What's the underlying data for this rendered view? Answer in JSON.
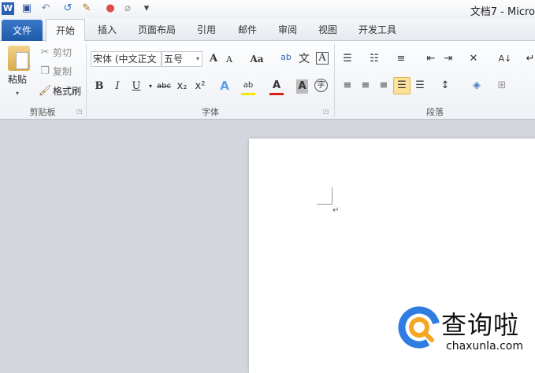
{
  "titlebar": {
    "title": "文档7 - Micro",
    "quick_access": [
      "word-logo-icon",
      "save-icon",
      "undo-icon",
      "redo-icon",
      "format-icon",
      "color-icon",
      "draw-icon",
      "customize-icon"
    ]
  },
  "tabs": [
    {
      "label": "文件"
    },
    {
      "label": "开始"
    },
    {
      "label": "插入"
    },
    {
      "label": "页面布局"
    },
    {
      "label": "引用"
    },
    {
      "label": "邮件"
    },
    {
      "label": "审阅"
    },
    {
      "label": "视图"
    },
    {
      "label": "开发工具"
    }
  ],
  "clipboard": {
    "label": "剪贴板",
    "paste": "粘贴",
    "cut": "剪切",
    "copy": "复制",
    "format_painter": "格式刷"
  },
  "font": {
    "label": "字体",
    "font_name": "宋体 (中文正文",
    "font_size": "五号",
    "bold": "B",
    "italic": "I",
    "underline": "U",
    "strike": "abc",
    "subscript": "x₂",
    "superscript": "x²",
    "change_case": "Aa",
    "grow": "A",
    "shrink": "A",
    "font_color_accent": "#d81e1e",
    "highlight_accent": "#f5e600"
  },
  "paragraph": {
    "label": "段落"
  },
  "document": {
    "paragraph_mark": "↵"
  },
  "watermark": {
    "brand": "查询啦",
    "url": "chaxunla.com",
    "accent_blue": "#2f7de1",
    "accent_orange": "#f5a623"
  }
}
